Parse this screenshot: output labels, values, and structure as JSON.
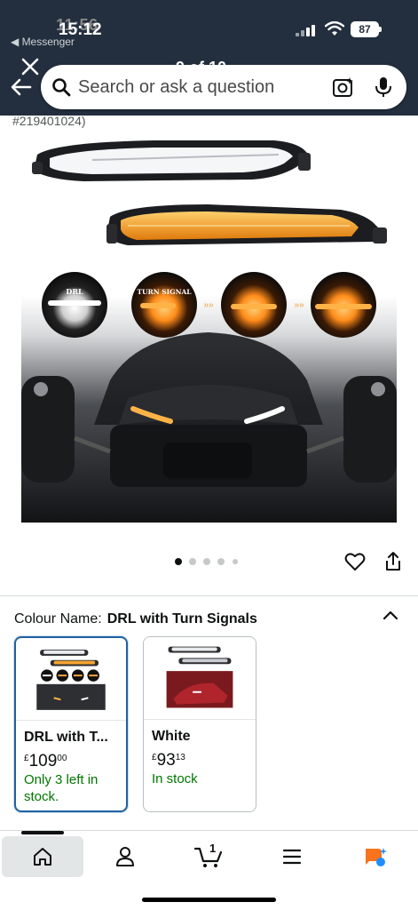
{
  "status_bar": {
    "time": "15:12",
    "time_behind": "11:56",
    "back_app": "◀ Messenger",
    "battery": "87"
  },
  "header": {
    "counter": "9 of 10"
  },
  "search": {
    "placeholder": "Search or ask a question"
  },
  "product": {
    "asin_fragment": "#219401024)",
    "image_labels": {
      "drl": "DRL",
      "turn": "TURN SIGNAL"
    },
    "image_dots": {
      "count": 5,
      "active": 0
    }
  },
  "colour": {
    "label": "Colour Name:",
    "value": "DRL with Turn Signals",
    "options": [
      {
        "name": "DRL with T...",
        "currency": "£",
        "whole": "109",
        "fraction": "00",
        "stock": "Only 3 left in stock.",
        "selected": true
      },
      {
        "name": "White",
        "currency": "£",
        "whole": "93",
        "fraction": "13",
        "stock": "In stock",
        "selected": false
      }
    ]
  },
  "bottom_nav": {
    "cart_count": "1",
    "items": [
      "home-icon",
      "account-icon",
      "cart-icon",
      "menu-icon",
      "rufus-icon"
    ]
  },
  "colors": {
    "header": "#232f3e",
    "in_stock": "#007600",
    "selected_border": "#2162a1"
  }
}
